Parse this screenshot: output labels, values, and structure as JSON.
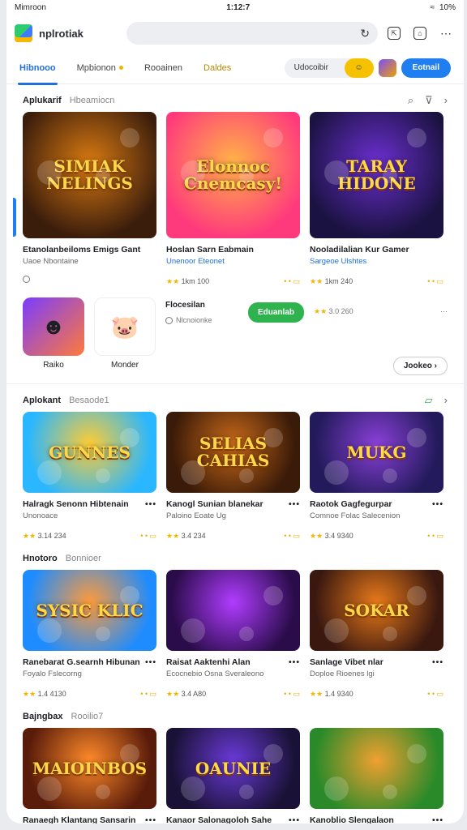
{
  "status": {
    "carrier": "Mimroon",
    "time": "1:12:7",
    "battery": "10%"
  },
  "header": {
    "app_name": "nplrotiak"
  },
  "tabs": [
    {
      "label": "Hibnooo",
      "active": true
    },
    {
      "label": "Mpbionon",
      "active": false
    },
    {
      "label": "Rooainen",
      "active": false
    },
    {
      "label": "Daldes",
      "active": false
    }
  ],
  "tab_actions": {
    "search_label": "Udocoibir",
    "primary_label": "Eotnail"
  },
  "section1": {
    "title": "Aplukarif",
    "subtitle": "Hbeamiocn"
  },
  "top_cards": [
    {
      "art": "SIMIAK NELINGS",
      "title": "Etanolanbeiloms Emigs Gant",
      "sub": "Uaoe Nbontaine",
      "meta_left": "",
      "meta_right": "",
      "colors": [
        "#3b1d0c",
        "#d97a12"
      ]
    },
    {
      "art": "Elonnoc Cnemcasy!",
      "title": "Hoslan Sarn Eabmain",
      "sub": "Unenoor Eteonet",
      "meta_left": "1km 100",
      "meta_right": "",
      "colors": [
        "#ff3a7c",
        "#ffb347"
      ]
    },
    {
      "art": "TARAY HIDONE",
      "title": "Nooladilalian Kur Gamer",
      "sub": "Sargeoe Ulshtes",
      "meta_left": "1km 240",
      "meta_right": "",
      "colors": [
        "#1a1240",
        "#6b2fd0"
      ]
    }
  ],
  "feature": {
    "apps": [
      {
        "label": "Raiko"
      },
      {
        "label": "Monder"
      }
    ],
    "name": "Flocesilan",
    "sub": "Nlcnoionke",
    "install_label": "Eduanlab",
    "rating": "3.0 260",
    "more_label": "Jookeo"
  },
  "sections": [
    {
      "title": "Aplokant",
      "subtitle": "Besaode1",
      "cards": [
        {
          "art": "GUNNES",
          "title": "Halragk Senonn Hibtenain",
          "sub": "Unonoace",
          "rating": "3.14 234",
          "colors": [
            "#2ab7ff",
            "#ffcc33"
          ]
        },
        {
          "art": "SELIAS CAHIAS",
          "title": "Kanogl Sunian blanekar",
          "sub": "Paloino Eoate Ug",
          "rating": "3.4 234",
          "colors": [
            "#3a1a08",
            "#c96a1a"
          ]
        },
        {
          "art": "MUKG",
          "title": "Raotok Gagfegurpar",
          "sub": "Comnoe Folac Salecenion",
          "rating": "3.4 9340",
          "colors": [
            "#221a5a",
            "#8a40d8"
          ]
        }
      ]
    },
    {
      "title": "Hnotoro",
      "subtitle": "Bonnioer",
      "cards": [
        {
          "art": "SYSIC KLIC",
          "title": "Ranebarat G.searnh Hibunan",
          "sub": "Foyalo Fslecorng",
          "rating": "1.4 4130",
          "colors": [
            "#1e8cff",
            "#ff9a3a"
          ]
        },
        {
          "art": "",
          "title": "Raisat Aaktenhi Alan",
          "sub": "Ecocnebio Osna Sveraleono",
          "rating": "3.4 A80",
          "colors": [
            "#2a0c4a",
            "#b03cff"
          ]
        },
        {
          "art": "SOKAR",
          "title": "Sanlage Vibet nlar",
          "sub": "Doploe Rioenes lgi",
          "rating": "1.4 9340",
          "colors": [
            "#3a1810",
            "#e87a1a"
          ]
        }
      ]
    },
    {
      "title": "Bajngbax",
      "subtitle": "Rooilio7",
      "cards": [
        {
          "art": "MAIOINBOS",
          "title": "Ranaegh Klantang Sansarin",
          "sub": "",
          "rating": "",
          "colors": [
            "#5a1c0a",
            "#ff8a2a"
          ]
        },
        {
          "art": "OAUNIE",
          "title": "Kanaor Salonagoloh Sahe",
          "sub": "",
          "rating": "",
          "colors": [
            "#1a1236",
            "#6a3ad8"
          ]
        },
        {
          "art": "",
          "title": "Kanoblio Slengalaon",
          "sub": "",
          "rating": "",
          "colors": [
            "#2a8a2a",
            "#f0a030"
          ]
        }
      ]
    }
  ]
}
